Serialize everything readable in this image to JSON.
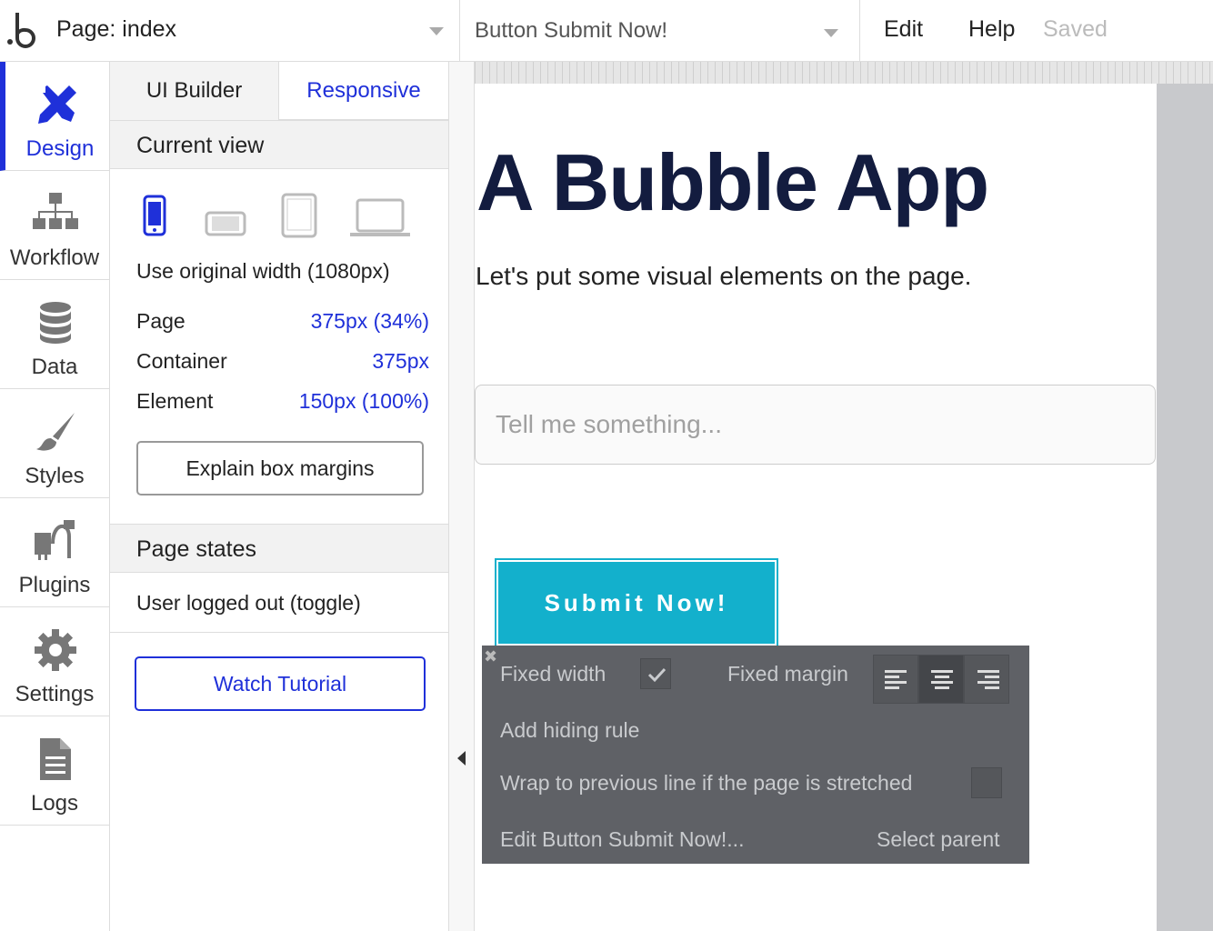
{
  "topbar": {
    "page_label": "Page: index",
    "element_label": "Button Submit Now!",
    "menu_edit": "Edit",
    "menu_help": "Help",
    "status": "Saved"
  },
  "nav": {
    "items": [
      {
        "label": "Design",
        "icon": "design-icon",
        "active": true
      },
      {
        "label": "Workflow",
        "icon": "workflow-icon"
      },
      {
        "label": "Data",
        "icon": "database-icon"
      },
      {
        "label": "Styles",
        "icon": "brush-icon"
      },
      {
        "label": "Plugins",
        "icon": "plug-icon"
      },
      {
        "label": "Settings",
        "icon": "gear-icon"
      },
      {
        "label": "Logs",
        "icon": "document-icon"
      }
    ]
  },
  "panel": {
    "tabs": {
      "ui_builder": "UI Builder",
      "responsive": "Responsive"
    },
    "current_view_title": "Current view",
    "devices": [
      "mobile-icon",
      "mobile-landscape-icon",
      "tablet-icon",
      "laptop-icon"
    ],
    "original_width": "Use original width (1080px)",
    "rows": [
      {
        "label": "Page",
        "value": "375px (34%)"
      },
      {
        "label": "Container",
        "value": "375px"
      },
      {
        "label": "Element",
        "value": "150px (100%)"
      }
    ],
    "explain_button": "Explain box margins",
    "page_states_title": "Page states",
    "toggle_label": "User logged out (toggle)",
    "watch_button": "Watch Tutorial"
  },
  "canvas": {
    "title": "A Bubble App",
    "subtitle": "Let's put some visual elements on the page.",
    "input_placeholder": "Tell me something...",
    "submit_label": "Submit Now!"
  },
  "popover": {
    "fixed_width": "Fixed width",
    "fixed_width_checked": true,
    "fixed_margin": "Fixed margin",
    "add_hiding_rule": "Add hiding rule",
    "wrap_text": "Wrap to previous line if the page is stretched",
    "edit_element": "Edit Button Submit Now!...",
    "select_parent": "Select parent"
  },
  "colors": {
    "accent": "#1f30d9",
    "button": "#13b0cc",
    "title": "#131c3f",
    "popover_bg": "#5f6166"
  }
}
